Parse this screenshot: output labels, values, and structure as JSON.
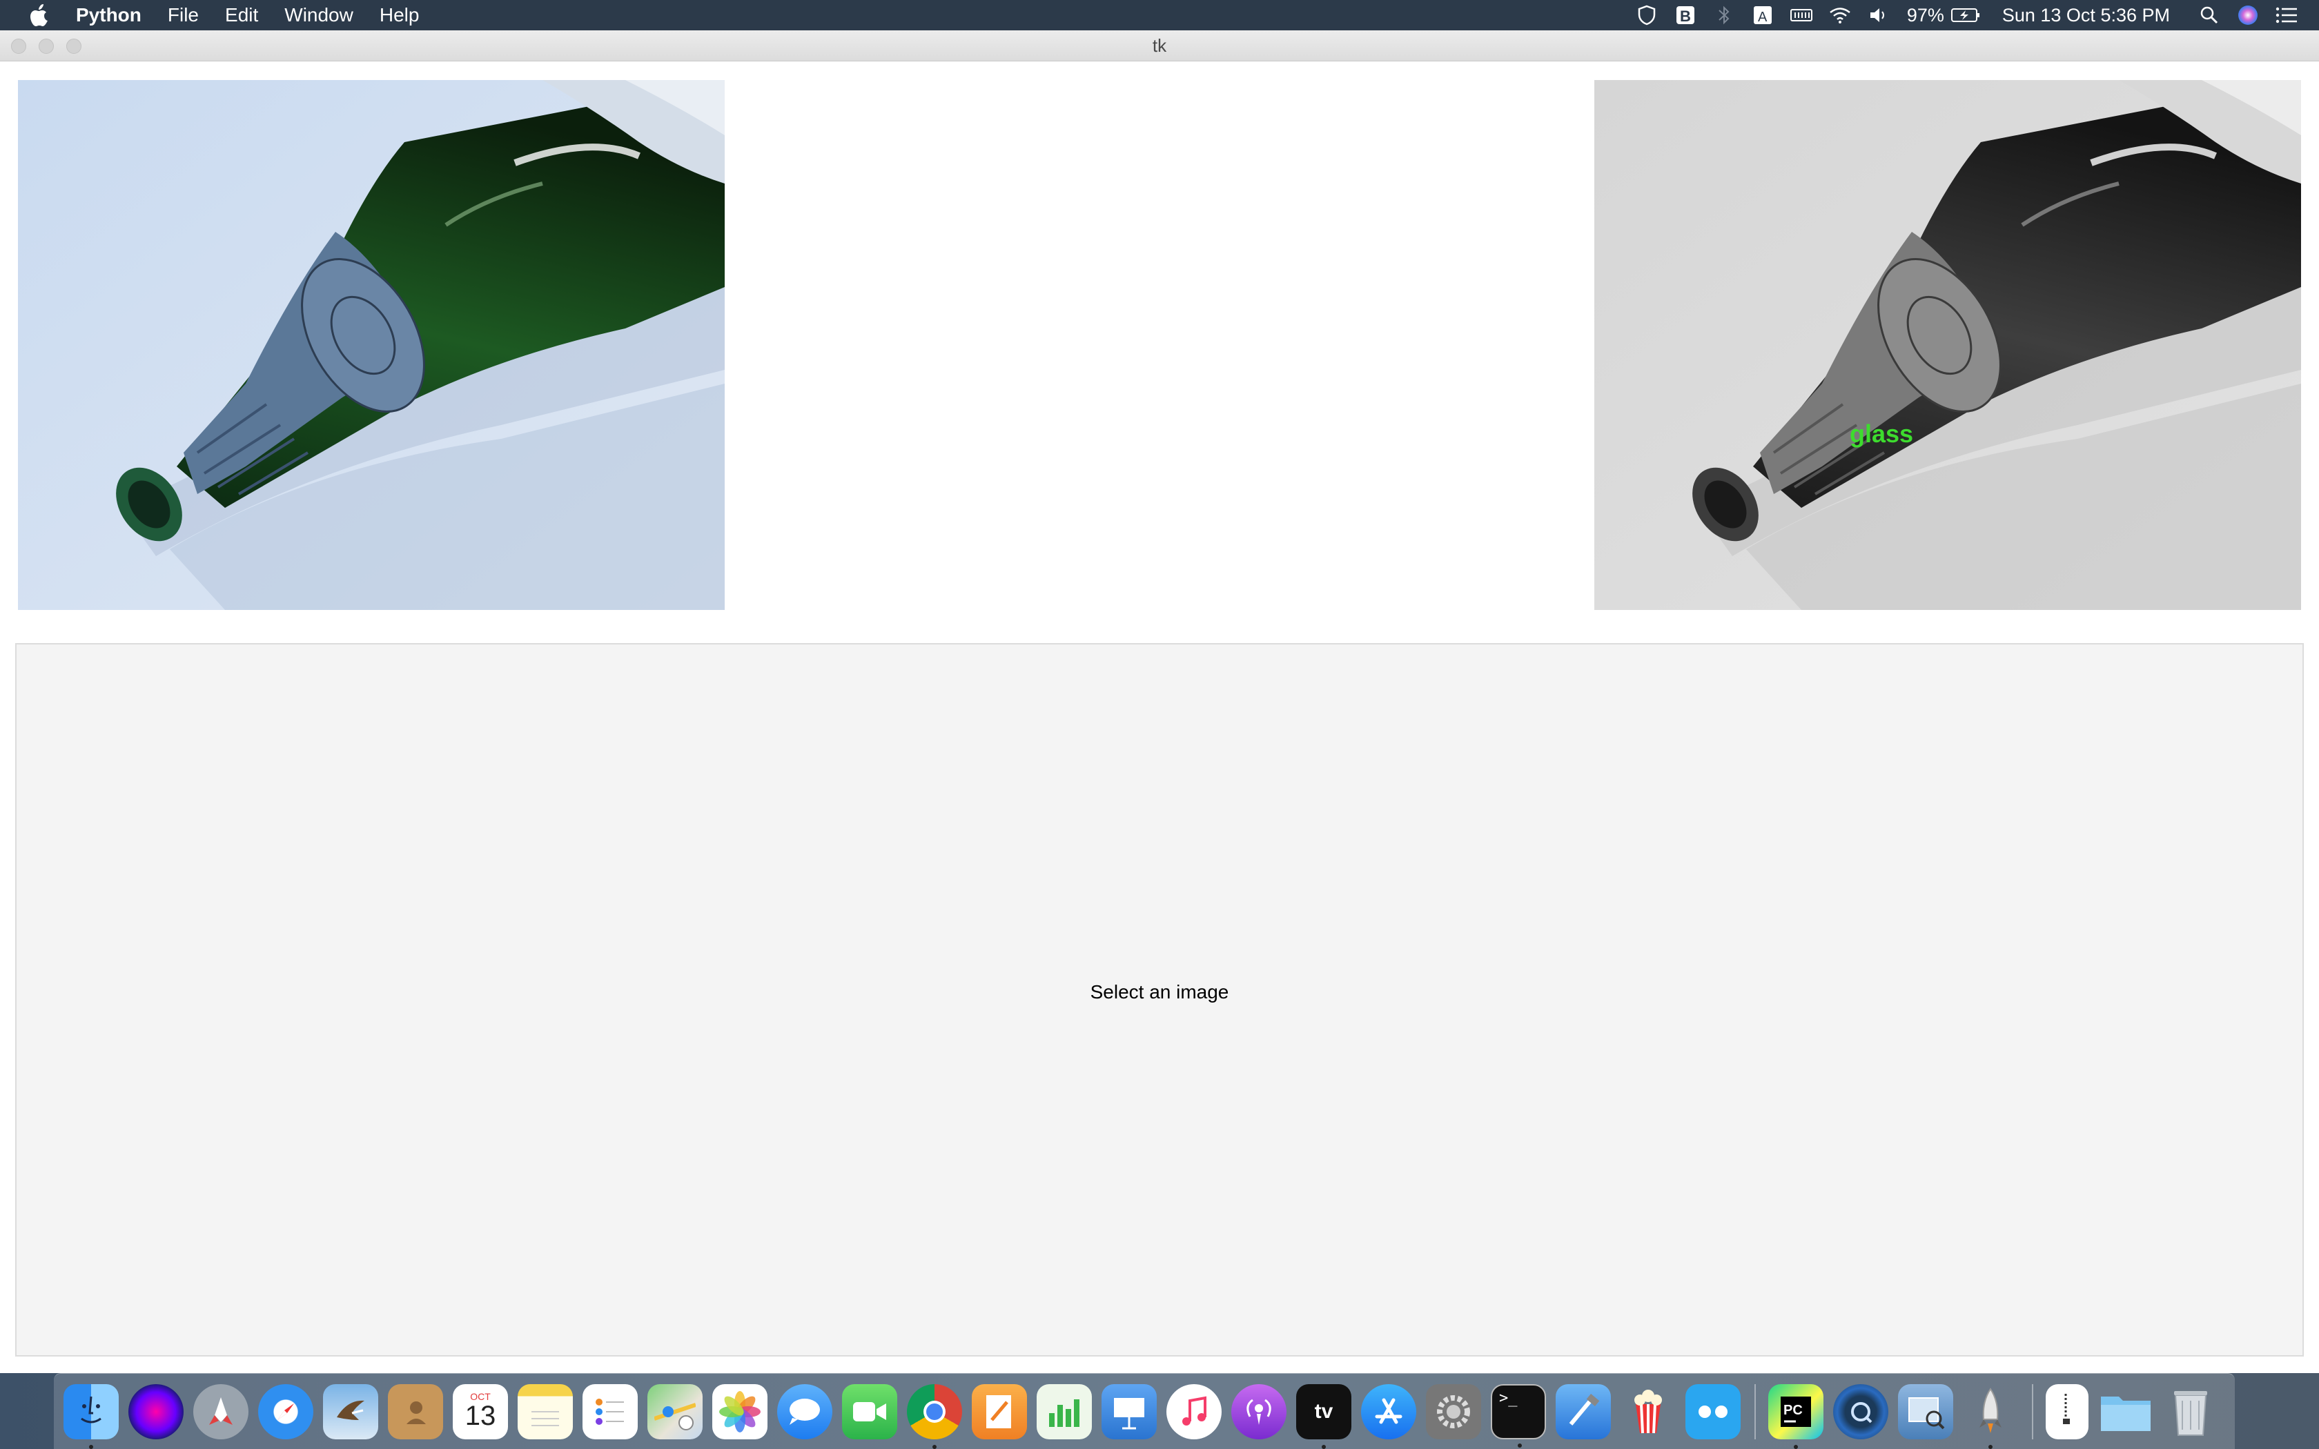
{
  "menubar": {
    "app_name": "Python",
    "menus": [
      "File",
      "Edit",
      "Window",
      "Help"
    ],
    "battery": "97%",
    "datetime": "Sun 13 Oct  5:36 PM"
  },
  "window": {
    "title": "tk"
  },
  "images": {
    "original_alt": "bottle photo",
    "processed_alt": "grayscale bottle photo",
    "detection_label": "glass",
    "detection_color": "#3ddc2e"
  },
  "panel": {
    "label": "Select an image"
  },
  "dock": {
    "calendar_month": "OCT",
    "calendar_day": "13",
    "items": [
      "Finder",
      "Siri",
      "Launchpad",
      "Safari",
      "Mail",
      "Contacts",
      "Calendar",
      "Notes",
      "Reminders",
      "Maps",
      "Photos",
      "Messages",
      "FaceTime",
      "Google Chrome",
      "Pages",
      "Numbers",
      "Keynote",
      "Music",
      "Podcasts",
      "TV",
      "App Store",
      "System Preferences",
      "Terminal",
      "Xcode",
      "Popcorn",
      "Flickr",
      "PyCharm",
      "QuickTime",
      "Preview",
      "Rocket",
      "Archive",
      "Folder",
      "Trash"
    ]
  }
}
